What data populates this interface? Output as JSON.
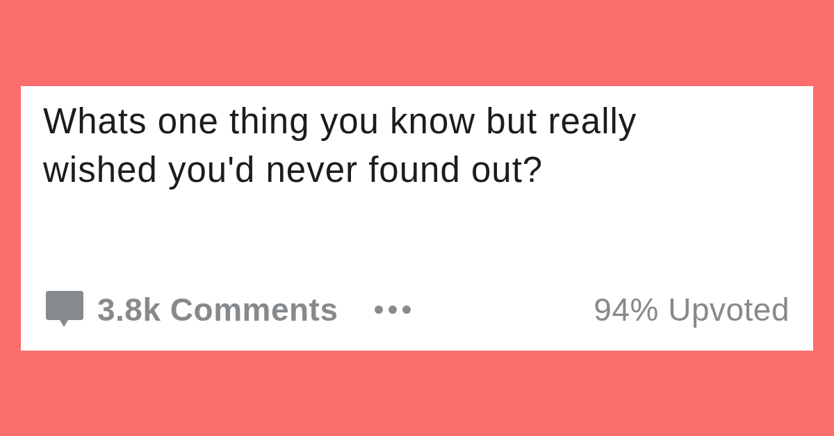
{
  "post": {
    "title": "Whats one thing you know but really wished you'd never found out?",
    "comments_label": "3.8k Comments",
    "upvoted_label": "94% Upvoted"
  }
}
